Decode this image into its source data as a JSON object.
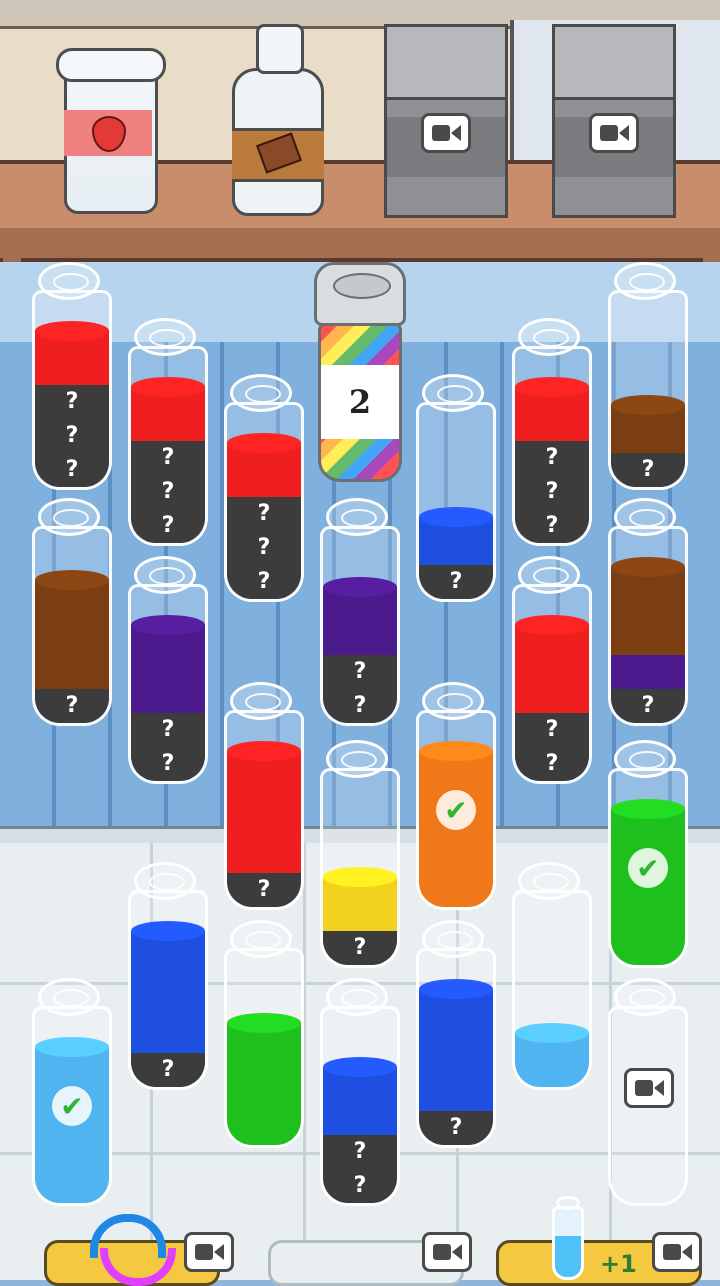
{
  "can": {
    "label": "2"
  },
  "bottom": {
    "plus_one": "+1"
  },
  "colors": {
    "red": "#f01f1f",
    "brown": "#7a3e12",
    "purple": "#4b1a8c",
    "blue": "#1f4fe0",
    "orange": "#f07818",
    "green": "#1ec01e",
    "yellow": "#f2d21c",
    "lightblue": "#4fb4f0",
    "hidden": "#3c3c3c"
  },
  "question_mark": "?",
  "check_mark": "✔"
}
